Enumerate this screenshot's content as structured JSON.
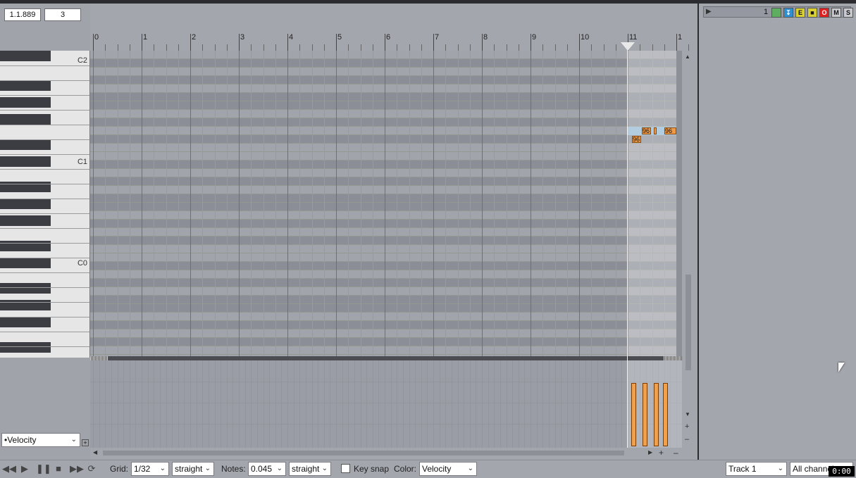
{
  "position": {
    "time": "1.1.889",
    "value": "3"
  },
  "piano": {
    "octave_labels": [
      "C2",
      "C1",
      "C0"
    ]
  },
  "ruler": {
    "bar_numbers": [
      "0",
      "1",
      "2",
      "3",
      "4",
      "5",
      "6",
      "7",
      "8",
      "9",
      "10",
      "11",
      "1"
    ]
  },
  "notes": {
    "velocity_labels": [
      "96",
      "96",
      "96"
    ]
  },
  "cc_lane": {
    "selector": "•Velocity"
  },
  "track_header": {
    "track_number": "1",
    "btn_e": "E",
    "btn_m": "M",
    "btn_s": "S"
  },
  "toolbar": {
    "grid_label": "Grid:",
    "grid_value": "1/32",
    "grid_type": "straight",
    "notes_label": "Notes:",
    "notes_value": "0.045",
    "notes_type": "straight",
    "keysnap_label": "Key snap",
    "keysnap_checked": false,
    "color_label": "Color:",
    "color_value": "Velocity",
    "track_value": "Track 1",
    "channel_value": "All channels",
    "clock": "0:00"
  },
  "colors": {
    "note_fill": "#ef9a48",
    "record_red": "#e02020",
    "arm_blue": "#2f8fd0"
  }
}
